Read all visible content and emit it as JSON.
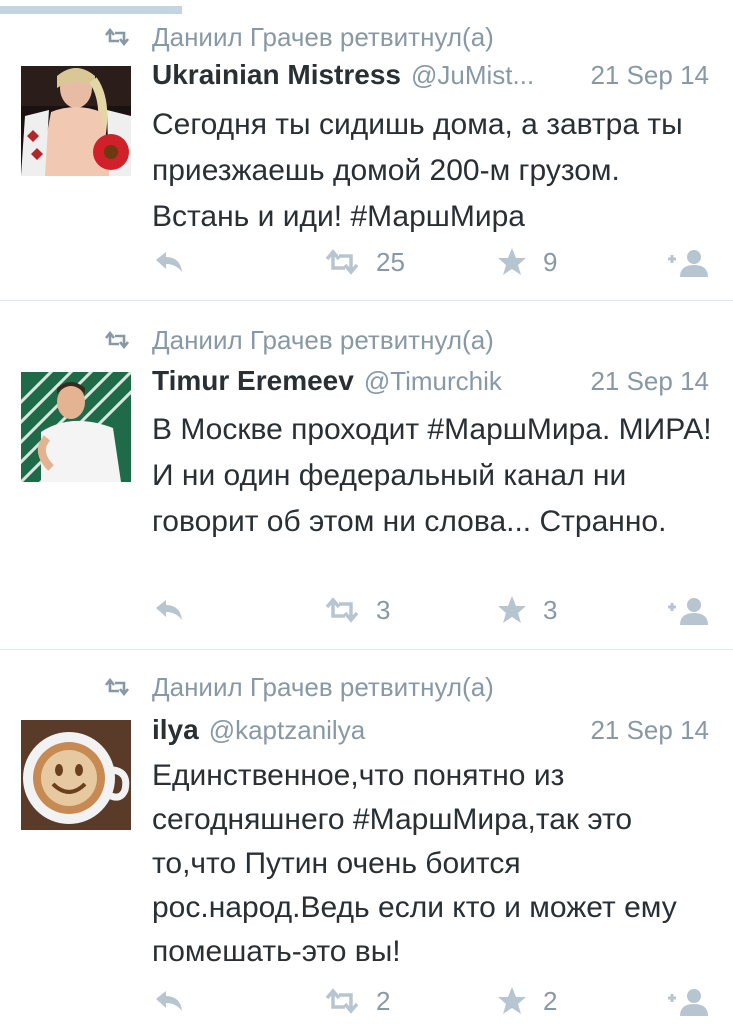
{
  "colors": {
    "text": "#292f33",
    "muted": "#8899a6",
    "icon": "#b7c5d1",
    "divider": "#e1e8ed"
  },
  "timeline": {
    "tweets": [
      {
        "retweeted_by": "Даниил Грачев ретвитнул(а)",
        "name": "Ukrainian Mistress",
        "handle": "@JuMist...",
        "date": "21 Sep 14",
        "text": "Сегодня ты сидишь дома, а завтра ты приезжаешь домой 200-м грузом. Встань и иди! #МаршМира",
        "retweets": "25",
        "favorites": "9",
        "avatar": "woman-with-red-flower"
      },
      {
        "retweeted_by": "Даниил Грачев ретвитнул(а)",
        "name": "Timur Eremeev",
        "handle": "@Timurchik",
        "date": "21 Sep 14",
        "text": "В Москве проходит #МаршМира. МИРА! И ни один федеральный канал ни говорит об этом ни слова... Странно.",
        "retweets": "3",
        "favorites": "3",
        "avatar": "man-in-white-tshirt"
      },
      {
        "retweeted_by": "Даниил Грачев ретвитнул(а)",
        "name": "ilya",
        "handle": "@kaptzanilya",
        "date": "21 Sep 14",
        "text": "Единственное,что понятно из сегодняшнего #МаршМира,так это то,что Путин очень боится рос.народ.Ведь если кто и может ему помешать-это вы!",
        "retweets": "2",
        "favorites": "2",
        "avatar": "latte-smiley-face"
      }
    ]
  }
}
